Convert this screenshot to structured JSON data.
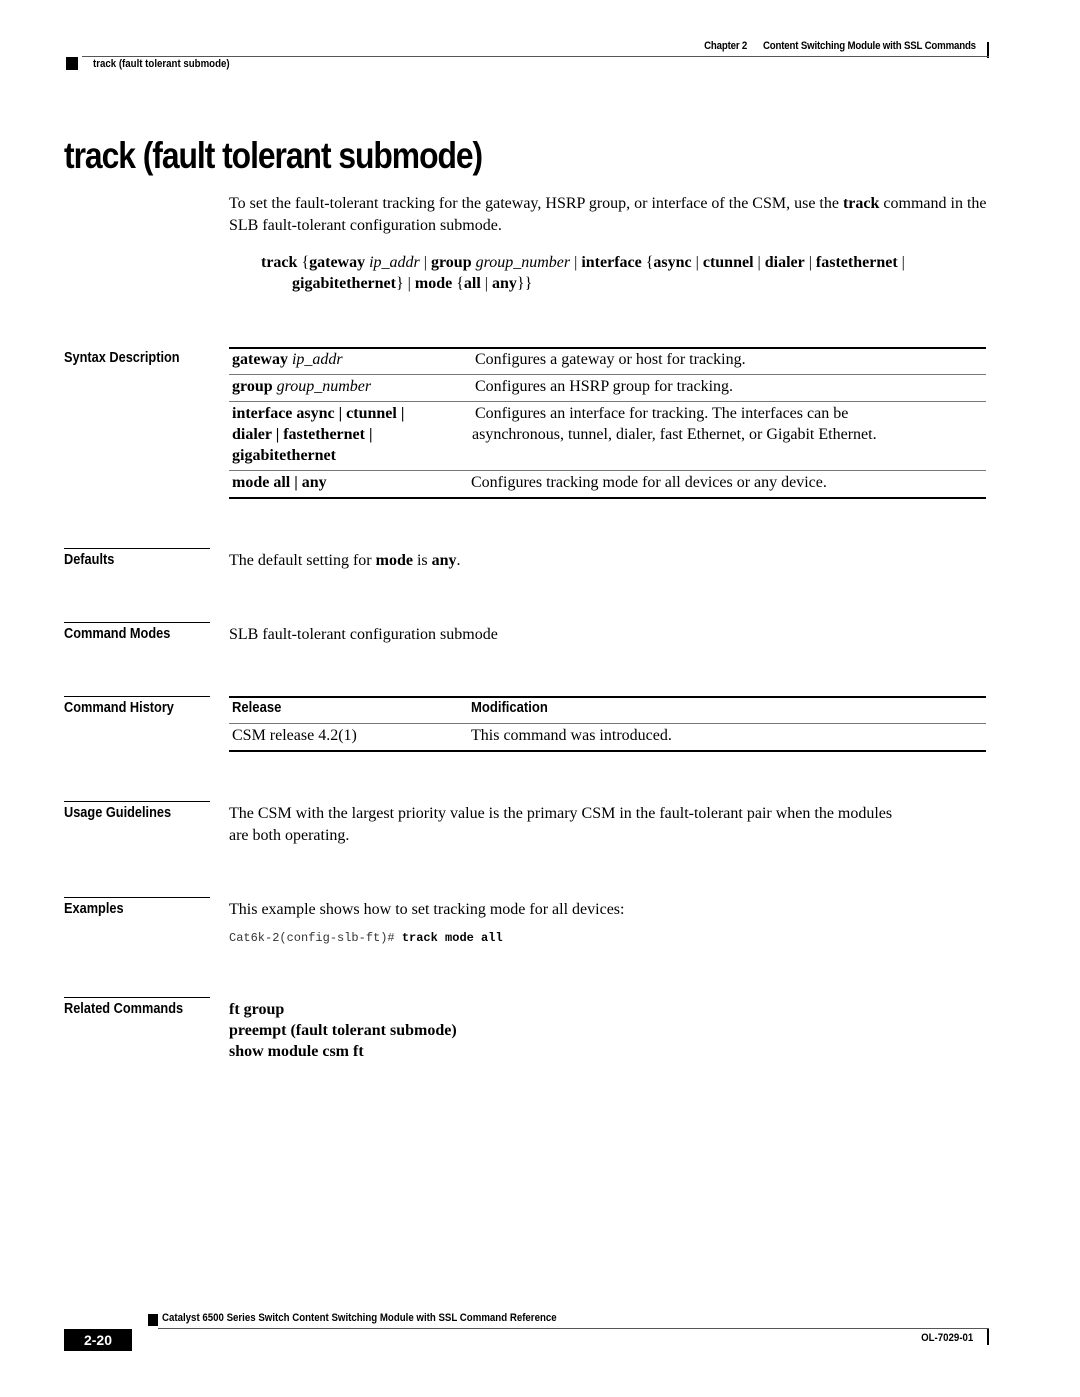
{
  "header": {
    "chapter": "Chapter 2",
    "chapter_title": "Content Switching Module with SSL Commands",
    "section": "track (fault tolerant submode)"
  },
  "title": "track (fault tolerant submode)",
  "intro": {
    "before": "To set the fault-tolerant tracking for the gateway, HSRP group, or interface of the CSM, use the ",
    "keyword": "track",
    "after": " command in the SLB fault-tolerant configuration submode."
  },
  "syntax": {
    "line1": [
      {
        "t": "track ",
        "s": "b"
      },
      {
        "t": "{",
        "s": "n"
      },
      {
        "t": "gateway ",
        "s": "b"
      },
      {
        "t": "ip_addr",
        "s": "i"
      },
      {
        "t": " | ",
        "s": "n"
      },
      {
        "t": "group ",
        "s": "b"
      },
      {
        "t": "group_number",
        "s": "i"
      },
      {
        "t": " | ",
        "s": "n"
      },
      {
        "t": "interface ",
        "s": "b"
      },
      {
        "t": "{",
        "s": "n"
      },
      {
        "t": "async",
        "s": "b"
      },
      {
        "t": " | ",
        "s": "n"
      },
      {
        "t": "ctunnel",
        "s": "b"
      },
      {
        "t": " | ",
        "s": "n"
      },
      {
        "t": "dialer",
        "s": "b"
      },
      {
        "t": " | ",
        "s": "n"
      },
      {
        "t": "fastethernet",
        "s": "b"
      },
      {
        "t": " |",
        "s": "n"
      }
    ],
    "line2": [
      {
        "t": "gigabitethernet",
        "s": "b"
      },
      {
        "t": "} | ",
        "s": "n"
      },
      {
        "t": "mode ",
        "s": "b"
      },
      {
        "t": "{",
        "s": "n"
      },
      {
        "t": "all",
        "s": "b"
      },
      {
        "t": " | ",
        "s": "n"
      },
      {
        "t": "any",
        "s": "b"
      },
      {
        "t": "}}",
        "s": "n"
      }
    ]
  },
  "sections": {
    "syntax_description": "Syntax Description",
    "defaults": "Defaults",
    "command_modes": "Command Modes",
    "command_history": "Command History",
    "usage_guidelines": "Usage Guidelines",
    "examples": "Examples",
    "related_commands": "Related Commands"
  },
  "syntax_table": {
    "rows": [
      {
        "param_bold": "gateway ",
        "param_italic": "ip_addr",
        "desc": [
          "Configures a gateway or host for tracking."
        ]
      },
      {
        "param_bold": "group ",
        "param_italic": "group_number",
        "desc": [
          "Configures an HSRP group for tracking."
        ]
      },
      {
        "param_lines": [
          "interface async | ctunnel |",
          "dialer | fastethernet |",
          "gigabitethernet"
        ],
        "desc": [
          "Configures an interface for tracking. The interfaces can be",
          "asynchronous, tunnel, dialer, fast Ethernet, or Gigabit Ethernet."
        ]
      },
      {
        "param_bold": "mode all | any",
        "param_italic": "",
        "desc": [
          "Configures tracking mode for all devices or any device."
        ]
      }
    ]
  },
  "defaults": {
    "before": "The default setting for ",
    "kw1": "mode",
    "mid": " is ",
    "kw2": "any",
    "after": "."
  },
  "command_modes": "SLB fault-tolerant configuration submode",
  "command_history": {
    "headers": [
      "Release",
      "Modification"
    ],
    "rows": [
      [
        "CSM release 4.2(1)",
        "This command was introduced."
      ]
    ]
  },
  "usage_guidelines": {
    "line1": "The CSM with the largest priority value is the primary CSM in the fault-tolerant pair when the modules",
    "line2": "are both operating."
  },
  "examples": {
    "text": "This example shows how to set tracking mode for all devices:",
    "prompt": "Cat6k-2(config-slb-ft)# ",
    "command": "track mode all"
  },
  "related_commands": [
    "ft group",
    "preempt (fault tolerant submode)",
    "show module csm ft"
  ],
  "footer": {
    "book_title": "Catalyst 6500 Series Switch Content Switching Module with SSL Command Reference",
    "page": "2-20",
    "doc_number": "OL-7029-01"
  }
}
